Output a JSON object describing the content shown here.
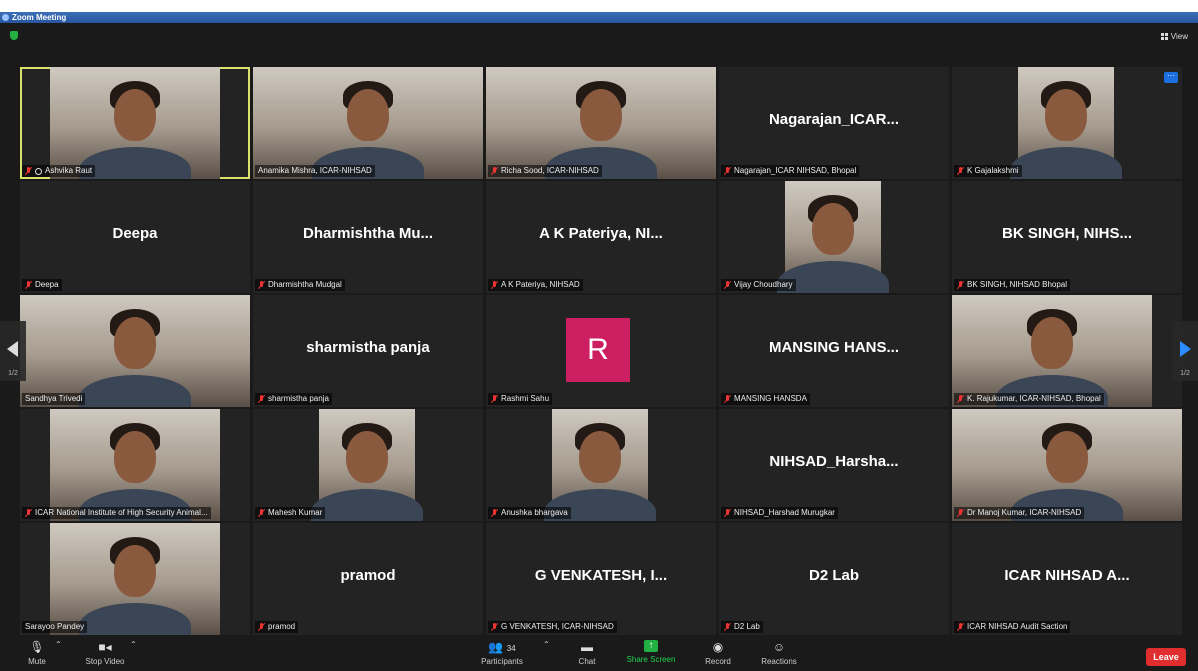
{
  "window": {
    "title": "Zoom Meeting"
  },
  "header": {
    "view_label": "View"
  },
  "pagination": {
    "current": "1/2"
  },
  "participants": [
    {
      "label": "Ashvika Raut",
      "active": true,
      "video": true
    },
    {
      "label": "Anamika Mishra, ICAR-NIHSAD",
      "video": true
    },
    {
      "label": "Richa Sood, ICAR-NIHSAD",
      "video": true
    },
    {
      "label": "Nagarajan_ICAR NIHSAD, Bhopal",
      "display": "Nagarajan_ICAR..."
    },
    {
      "label": "K Gajalakshmi",
      "video": true
    },
    {
      "label": "Deepa",
      "display": "Deepa"
    },
    {
      "label": "Dharmishtha Mudgal",
      "display": "Dharmishtha  Mu..."
    },
    {
      "label": "A K Pateriya, NIHSAD",
      "display": "A K Pateriya, NI..."
    },
    {
      "label": "Vijay Choudhary",
      "video": true
    },
    {
      "label": "BK SINGH, NIHSAD Bhopal",
      "display": "BK SINGH, NIHS..."
    },
    {
      "label": "Sandhya Trivedi",
      "video": true
    },
    {
      "label": "sharmistha panja",
      "display": "sharmistha panja"
    },
    {
      "label": "Rashmi Sahu",
      "avatar": "R"
    },
    {
      "label": "MANSING HANSDA",
      "display": "MANSING  HANS..."
    },
    {
      "label": "K. Rajukumar, ICAR-NIHSAD, Bhopal",
      "video": true
    },
    {
      "label": "ICAR National Institute of High Security Animal...",
      "video": true
    },
    {
      "label": "Mahesh Kumar",
      "video": true
    },
    {
      "label": "Anushka bhargava",
      "video": true
    },
    {
      "label": "NIHSAD_Harshad Murugkar",
      "display": "NIHSAD_Harsha..."
    },
    {
      "label": "Dr Manoj Kumar, ICAR-NIHSAD",
      "video": true
    },
    {
      "label": "Sarayoo Pandey",
      "video": true
    },
    {
      "label": "pramod",
      "display": "pramod"
    },
    {
      "label": "G VENKATESH, ICAR-NIHSAD",
      "display": "G VENKATESH, I..."
    },
    {
      "label": "D2 Lab",
      "display": "D2 Lab"
    },
    {
      "label": "ICAR NIHSAD Audit Saction",
      "display": "ICAR NIHSAD A..."
    }
  ],
  "toolbar": {
    "mute": "Mute",
    "stop_video": "Stop Video",
    "participants": "Participants",
    "participant_count": "34",
    "chat": "Chat",
    "share_screen": "Share Screen",
    "record": "Record",
    "reactions": "Reactions",
    "leave": "Leave"
  },
  "colors": {
    "active_speaker_border": "#d9e26a",
    "leave_button": "#e02d2d",
    "share_screen": "#23b043",
    "avatar_bg": "#cc1f62",
    "next_page_arrow": "#2d8cff"
  }
}
